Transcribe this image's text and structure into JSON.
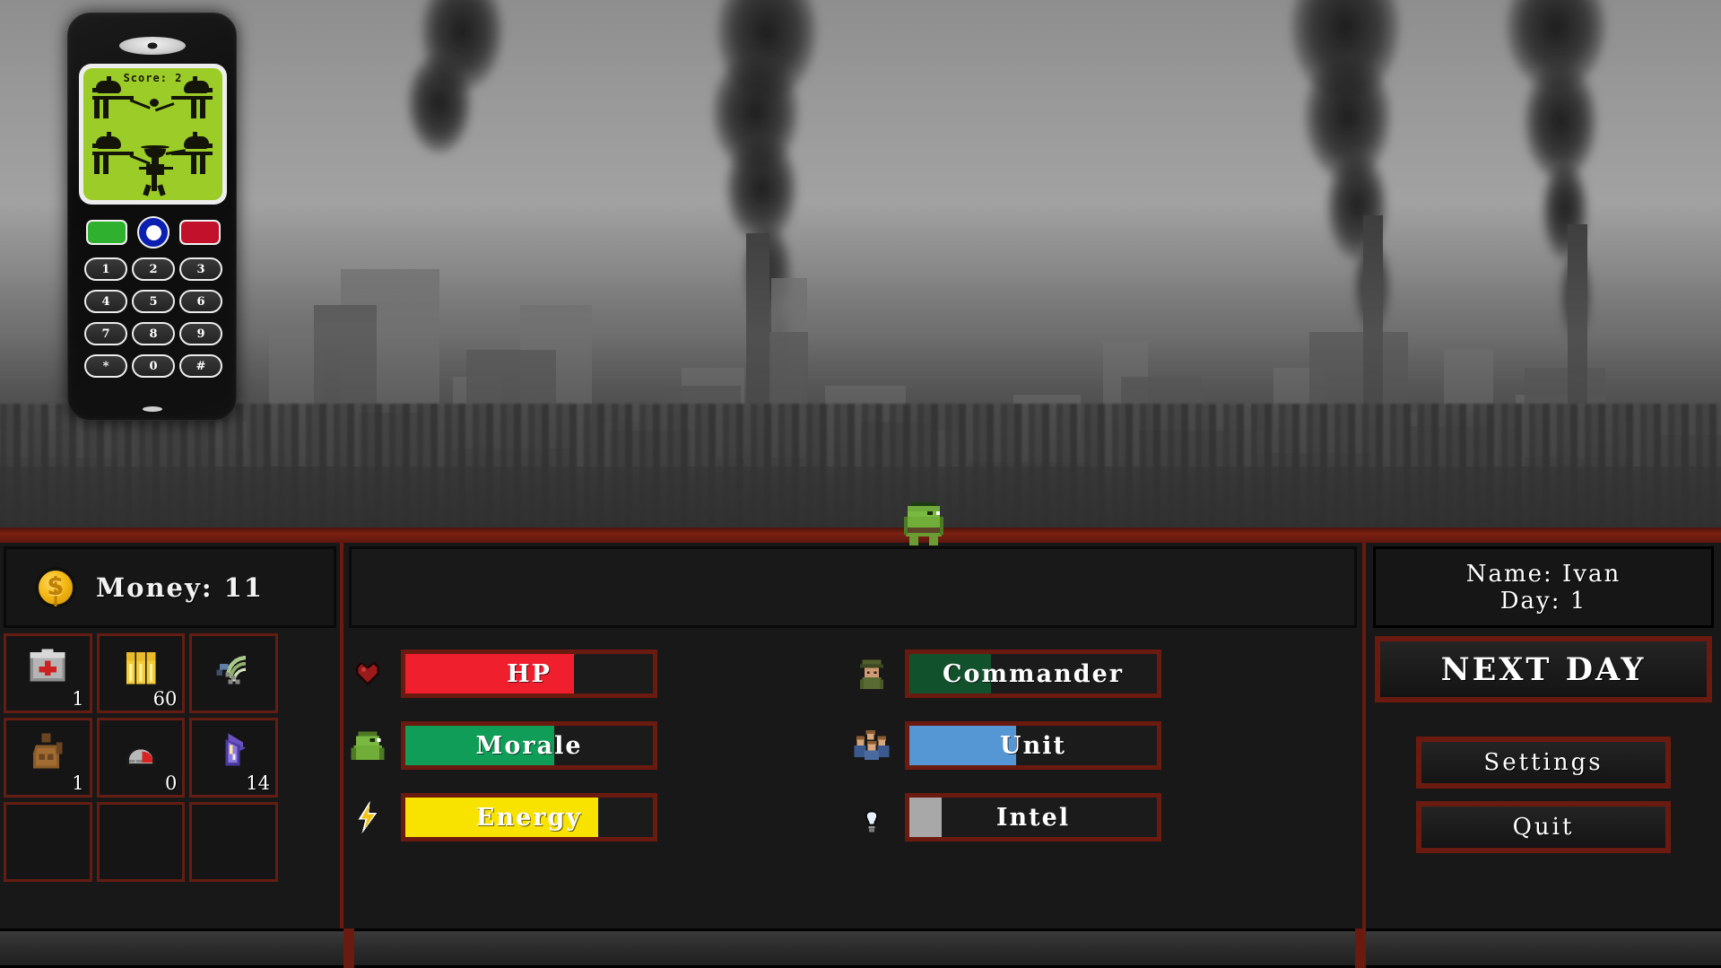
{
  "phone": {
    "lcd": {
      "score_label": "Score:",
      "score_value": "2",
      "game_name": "nokia-egg-catch-game"
    },
    "softkeys": [
      {
        "name": "call-key",
        "label": "",
        "color": "#2fb02f"
      },
      {
        "name": "nav-key",
        "label": "",
        "color": "#0b1fb0"
      },
      {
        "name": "end-key",
        "label": "",
        "color": "#c2112a"
      }
    ],
    "keypad": [
      "1",
      "2",
      "3",
      "4",
      "5",
      "6",
      "7",
      "8",
      "9",
      "*",
      "0",
      "#"
    ]
  },
  "scene": {
    "description": "ruined-city-skyline",
    "player_sprite": "green-orc-character"
  },
  "hud": {
    "money": {
      "icon": "coin-icon",
      "label": "Money: 11",
      "value": "11"
    },
    "inventory": [
      {
        "slot": 1,
        "icon": "medkit-icon",
        "qty": "1"
      },
      {
        "slot": 2,
        "icon": "ammo-icon",
        "qty": "60"
      },
      {
        "slot": 3,
        "icon": "radio-signal-icon",
        "qty": ""
      },
      {
        "slot": 4,
        "icon": "jug-icon",
        "qty": "1"
      },
      {
        "slot": 5,
        "icon": "helmet-icon",
        "qty": "0"
      },
      {
        "slot": 6,
        "icon": "crystal-icon",
        "qty": "14"
      },
      {
        "slot": 7,
        "icon": "",
        "qty": ""
      },
      {
        "slot": 8,
        "icon": "",
        "qty": ""
      },
      {
        "slot": 9,
        "icon": "",
        "qty": ""
      }
    ],
    "stats_left": [
      {
        "icon": "heart-icon",
        "label": "HP",
        "percent": 68,
        "color": "#f01f2e"
      },
      {
        "icon": "orc-face-icon",
        "label": "Morale",
        "percent": 60,
        "color": "#0f9d58"
      },
      {
        "icon": "lightning-icon",
        "label": "Energy",
        "percent": 78,
        "color": "#f8e200"
      }
    ],
    "stats_right": [
      {
        "icon": "soldier-icon",
        "label": "Commander",
        "percent": 33,
        "color": "#11512c"
      },
      {
        "icon": "squad-icon",
        "label": "Unit",
        "percent": 43,
        "color": "#5596d4"
      },
      {
        "icon": "lightbulb-icon",
        "label": "Intel",
        "percent": 13,
        "color": "#a8a8a8"
      }
    ],
    "nameplate": {
      "name_line": "Name: Ivan",
      "day_line": "Day: 1",
      "name_value": "Ivan",
      "day_value": "1"
    },
    "buttons": {
      "next_day": "NEXT DAY",
      "settings": "Settings",
      "quit": "Quit"
    }
  },
  "colors": {
    "frame_red": "#6b1a10",
    "panel_bg": "#191919",
    "hud_bg": "#181818",
    "text": "#f2f2f2"
  }
}
